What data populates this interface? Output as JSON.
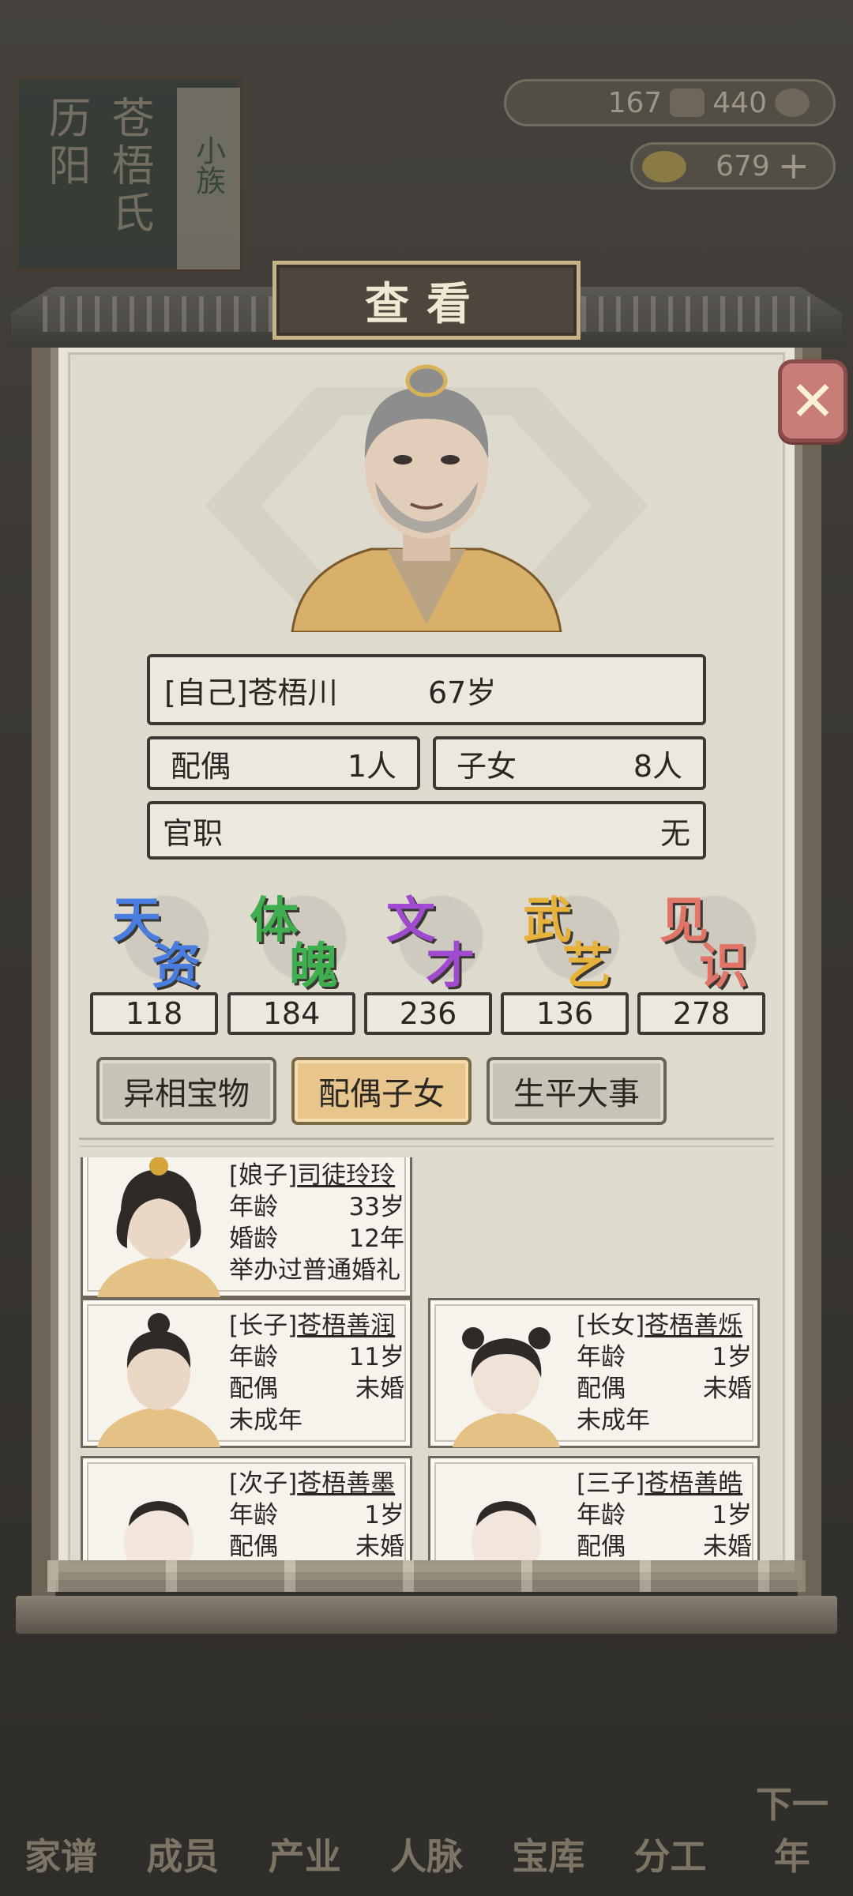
{
  "background": {
    "book": {
      "left_col": "历阳",
      "right_col": "苍梧氏",
      "small_tab": "小族"
    },
    "resources": {
      "coin_a": "167",
      "coin_b": "440",
      "gold": "679"
    },
    "bottom_nav": [
      "家谱",
      "成员",
      "产业",
      "人脉",
      "宝库",
      "分工",
      "下一年"
    ]
  },
  "dialog": {
    "title": "查看",
    "close_label": "✕",
    "person": {
      "name": "[自己]苍梧川",
      "age": "67岁",
      "spouse_label": "配偶",
      "spouse_count": "1人",
      "children_label": "子女",
      "children_count": "8人",
      "office_label": "官职",
      "office_value": "无"
    },
    "stats": [
      {
        "c1": "天",
        "c2": "资",
        "value": "118",
        "color": "#4a7de0"
      },
      {
        "c1": "体",
        "c2": "魄",
        "value": "184",
        "color": "#3fae4f"
      },
      {
        "c1": "文",
        "c2": "才",
        "value": "236",
        "color": "#a04ad0"
      },
      {
        "c1": "武",
        "c2": "艺",
        "value": "136",
        "color": "#e6b23c"
      },
      {
        "c1": "见",
        "c2": "识",
        "value": "278",
        "color": "#e07568"
      }
    ],
    "tabs": [
      "异相宝物",
      "配偶子女",
      "生平大事"
    ],
    "active_tab": "配偶子女",
    "cards": [
      {
        "title_prefix": "[娘子]",
        "name": "司徒玲玲",
        "l1_label": "年龄",
        "l1_value": "33岁",
        "l2_label": "婚龄",
        "l2_value": "12年",
        "l3": "举办过普通婚礼"
      },
      {
        "title_prefix": "[长子]",
        "name": "苍梧善润",
        "l1_label": "年龄",
        "l1_value": "11岁",
        "l2_label": "配偶",
        "l2_value": "未婚",
        "l3": "未成年"
      },
      {
        "title_prefix": "[长女]",
        "name": "苍梧善烁",
        "l1_label": "年龄",
        "l1_value": "1岁",
        "l2_label": "配偶",
        "l2_value": "未婚",
        "l3": "未成年"
      },
      {
        "title_prefix": "[次子]",
        "name": "苍梧善墨",
        "l1_label": "年龄",
        "l1_value": "1岁",
        "l2_label": "配偶",
        "l2_value": "未婚"
      },
      {
        "title_prefix": "[三子]",
        "name": "苍梧善皓",
        "l1_label": "年龄",
        "l1_value": "1岁",
        "l2_label": "配偶",
        "l2_value": "未婚"
      }
    ]
  }
}
